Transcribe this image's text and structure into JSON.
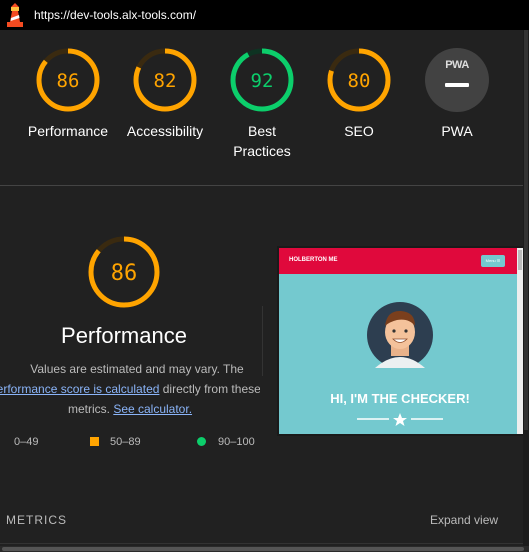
{
  "header": {
    "url": "https://dev-tools.alx-tools.com/"
  },
  "colors": {
    "average": "#ffa400",
    "pass": "#0cce6b",
    "fail": "#ff4e42",
    "background": "#212121"
  },
  "categories": [
    {
      "label": "Performance",
      "score": "86",
      "score_value": 86,
      "color": "#ffa400"
    },
    {
      "label": "Accessibility",
      "score": "82",
      "score_value": 82,
      "color": "#ffa400"
    },
    {
      "label": "Best Practices",
      "score": "92",
      "score_value": 92,
      "color": "#0cce6b"
    },
    {
      "label": "SEO",
      "score": "80",
      "score_value": 80,
      "color": "#ffa400"
    },
    {
      "label": "PWA",
      "badge": "PWA",
      "icon": "pwa-dash-icon"
    }
  ],
  "performance": {
    "score": "86",
    "score_value": 86,
    "title": "Performance",
    "desc_line1": "Values are estimated and may vary. The",
    "desc_link1": "performance score is calculated",
    "desc_line2_rest": " directly from these",
    "desc_line3_prefix": "metrics. ",
    "desc_link2": "See calculator."
  },
  "legend": [
    {
      "range": "0–49",
      "icon": "fail-triangle-icon"
    },
    {
      "range": "50–89",
      "icon": "average-square-icon"
    },
    {
      "range": "90–100",
      "icon": "pass-circle-icon"
    }
  ],
  "screenshot": {
    "brand": "HOLBERTON ME",
    "menu": "Menu ☰",
    "headline": "HI, I'M THE CHECKER!"
  },
  "metrics": {
    "heading": "METRICS",
    "expand": "Expand view"
  }
}
